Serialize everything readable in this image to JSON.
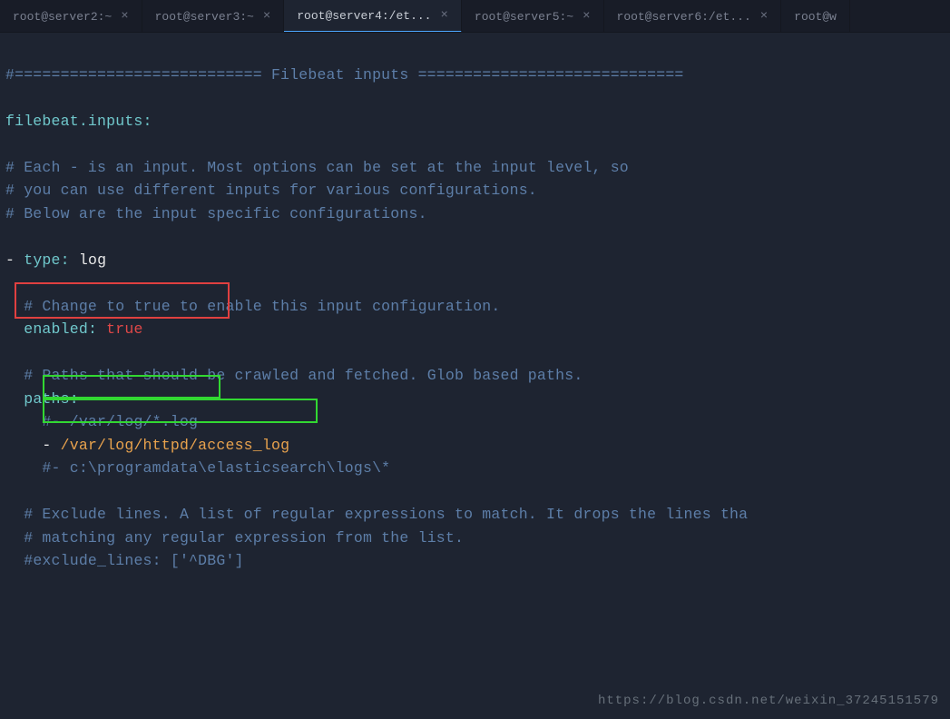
{
  "tabs": [
    {
      "label": "root@server2:~",
      "active": false
    },
    {
      "label": "root@server3:~",
      "active": false
    },
    {
      "label": "root@server4:/et...",
      "active": true
    },
    {
      "label": "root@server5:~",
      "active": false
    },
    {
      "label": "root@server6:/et...",
      "active": false
    },
    {
      "label": "root@w",
      "active": false
    }
  ],
  "close_glyph": "×",
  "code": {
    "header": "#=========================== Filebeat inputs =============================",
    "filebeat_key": "filebeat.inputs",
    "colon": ":",
    "comment_each1": "# Each - is an input. Most options can be set at the input level, so",
    "comment_each2": "# you can use different inputs for various configurations.",
    "comment_each3": "# Below are the input specific configurations.",
    "dash": "-",
    "type_key": "type",
    "type_val": "log",
    "comment_change": "# Change to true to enable this input configuration.",
    "enabled_key": "enabled",
    "enabled_val": "true",
    "comment_paths": "# Paths that should be crawled and fetched. Glob based paths.",
    "paths_key": "paths",
    "path_comment1": "#- /var/log/*.log",
    "path_dash": "-",
    "path_val": "/var/log/httpd/access_log",
    "path_comment2": "#- c:\\programdata\\elasticsearch\\logs\\*",
    "comment_excl1": "# Exclude lines. A list of regular expressions to match. It drops the lines tha",
    "comment_excl2": "# matching any regular expression from the list.",
    "comment_excl3": "#exclude_lines: ['^DBG']"
  },
  "watermark": "https://blog.csdn.net/weixin_37245151579"
}
